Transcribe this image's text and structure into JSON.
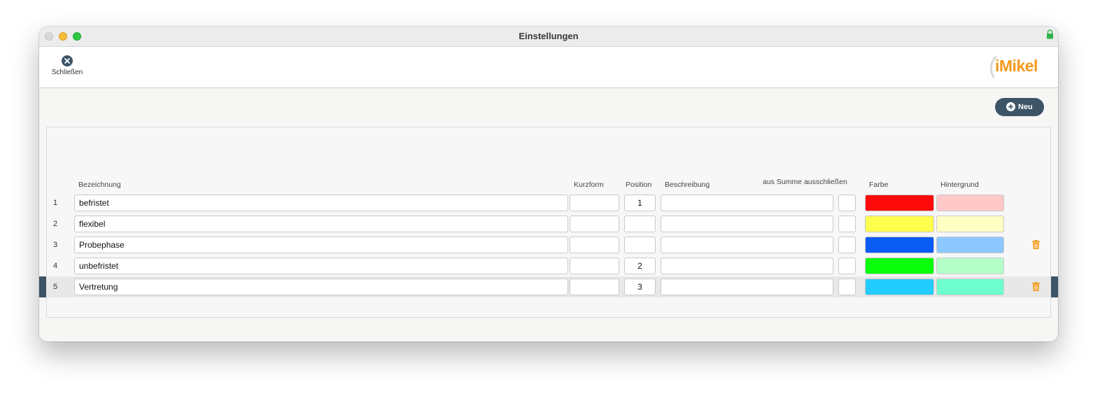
{
  "window": {
    "title": "Einstellungen"
  },
  "toolbar": {
    "close_label": "Schließen",
    "logo_text": "iMikel"
  },
  "actions": {
    "new_label": "Neu"
  },
  "table": {
    "headers": {
      "bezeichnung": "Bezeichnung",
      "kurzform": "Kurzform",
      "position": "Position",
      "beschreibung": "Beschreibung",
      "exclude": "aus Summe ausschließen",
      "farbe": "Farbe",
      "hintergrund": "Hintergrund"
    },
    "rows": [
      {
        "num": "1",
        "name": "befristet",
        "short": "",
        "position": "1",
        "description": "",
        "color": "#ff0a0a",
        "background": "#ffc9c9",
        "deletable": false,
        "selected": false
      },
      {
        "num": "2",
        "name": "flexibel",
        "short": "",
        "position": "",
        "description": "",
        "color": "#ffff4d",
        "background": "#ffffc4",
        "deletable": false,
        "selected": false
      },
      {
        "num": "3",
        "name": "Probephase",
        "short": "",
        "position": "",
        "description": "",
        "color": "#0a5cf5",
        "background": "#8cc8ff",
        "deletable": true,
        "selected": false
      },
      {
        "num": "4",
        "name": "unbefristet",
        "short": "",
        "position": "2",
        "description": "",
        "color": "#0aff0a",
        "background": "#b5ffc9",
        "deletable": false,
        "selected": false
      },
      {
        "num": "5",
        "name": "Vertretung",
        "short": "",
        "position": "3",
        "description": "",
        "color": "#22ccff",
        "background": "#6dffcc",
        "deletable": true,
        "selected": true
      }
    ]
  },
  "colors": {
    "accent": "#3d5466",
    "trash": "#f39a1b"
  }
}
